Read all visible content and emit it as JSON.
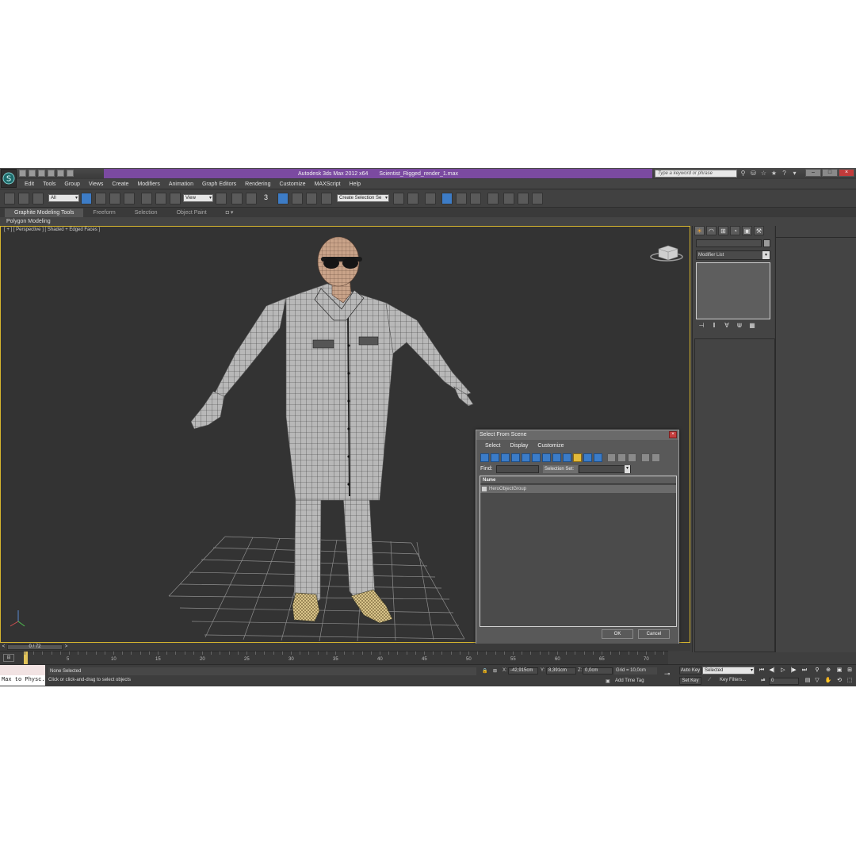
{
  "window": {
    "title_app": "Autodesk 3ds Max  2012 x64",
    "title_file": "Scientist_Rigged_render_1.max",
    "search_placeholder": "Type a keyword or phrase"
  },
  "menu": [
    "Edit",
    "Tools",
    "Group",
    "Views",
    "Create",
    "Modifiers",
    "Animation",
    "Graph Editors",
    "Rendering",
    "Customize",
    "MAXScript",
    "Help"
  ],
  "toolbar": {
    "filter_value": "All",
    "refcoord_value": "View",
    "snap_label": "3",
    "named_selection_value": "Create Selection Se"
  },
  "ribbon": {
    "tabs": [
      "Graphite Modeling Tools",
      "Freeform",
      "Selection",
      "Object Paint"
    ],
    "active_tab": "Graphite Modeling Tools",
    "sub_label": "Polygon Modeling"
  },
  "viewport": {
    "label": "[ + ] [ Perspective ] [ Shaded + Edged Faces ]",
    "viewcube_label": "FRONT"
  },
  "command_panel": {
    "modifier_list": "Modifier List",
    "tabs": [
      "create-icon",
      "modify-icon",
      "hierarchy-icon",
      "motion-icon",
      "display-icon",
      "utilities-icon"
    ]
  },
  "dialog": {
    "title": "Select From Scene",
    "menu": [
      "Select",
      "Display",
      "Customize"
    ],
    "find_label": "Find:",
    "selection_set_label": "Selection Set:",
    "column_name": "Name",
    "rows": [
      "HeroObjectGroup"
    ],
    "ok_label": "OK",
    "cancel_label": "Cancel"
  },
  "timeline": {
    "frame_readout": "0 / 72",
    "ticks": [
      "5",
      "10",
      "15",
      "20",
      "25",
      "30",
      "35",
      "40",
      "45",
      "50",
      "55",
      "60",
      "65",
      "70"
    ]
  },
  "status": {
    "maxscript_text": "Max to Physc.",
    "selection": "None Selected",
    "prompt": "Click or click-and-drag to select objects",
    "x_label": "X:",
    "x_value": "-42,915cm",
    "y_label": "Y:",
    "y_value": "8,391cm",
    "z_label": "Z:",
    "z_value": "0,0cm",
    "grid": "Grid = 10,0cm",
    "add_time_tag": "Add Time Tag",
    "auto_key": "Auto Key",
    "set_key": "Set Key",
    "selected_value": "Selected",
    "key_filters": "Key Filters...",
    "current_frame": "0"
  },
  "colors": {
    "title_accent": "#7b4aa1",
    "viewport_border": "#d6b52e",
    "viewport_bg": "#333333",
    "dialog_icons": "#3b7cc8"
  }
}
